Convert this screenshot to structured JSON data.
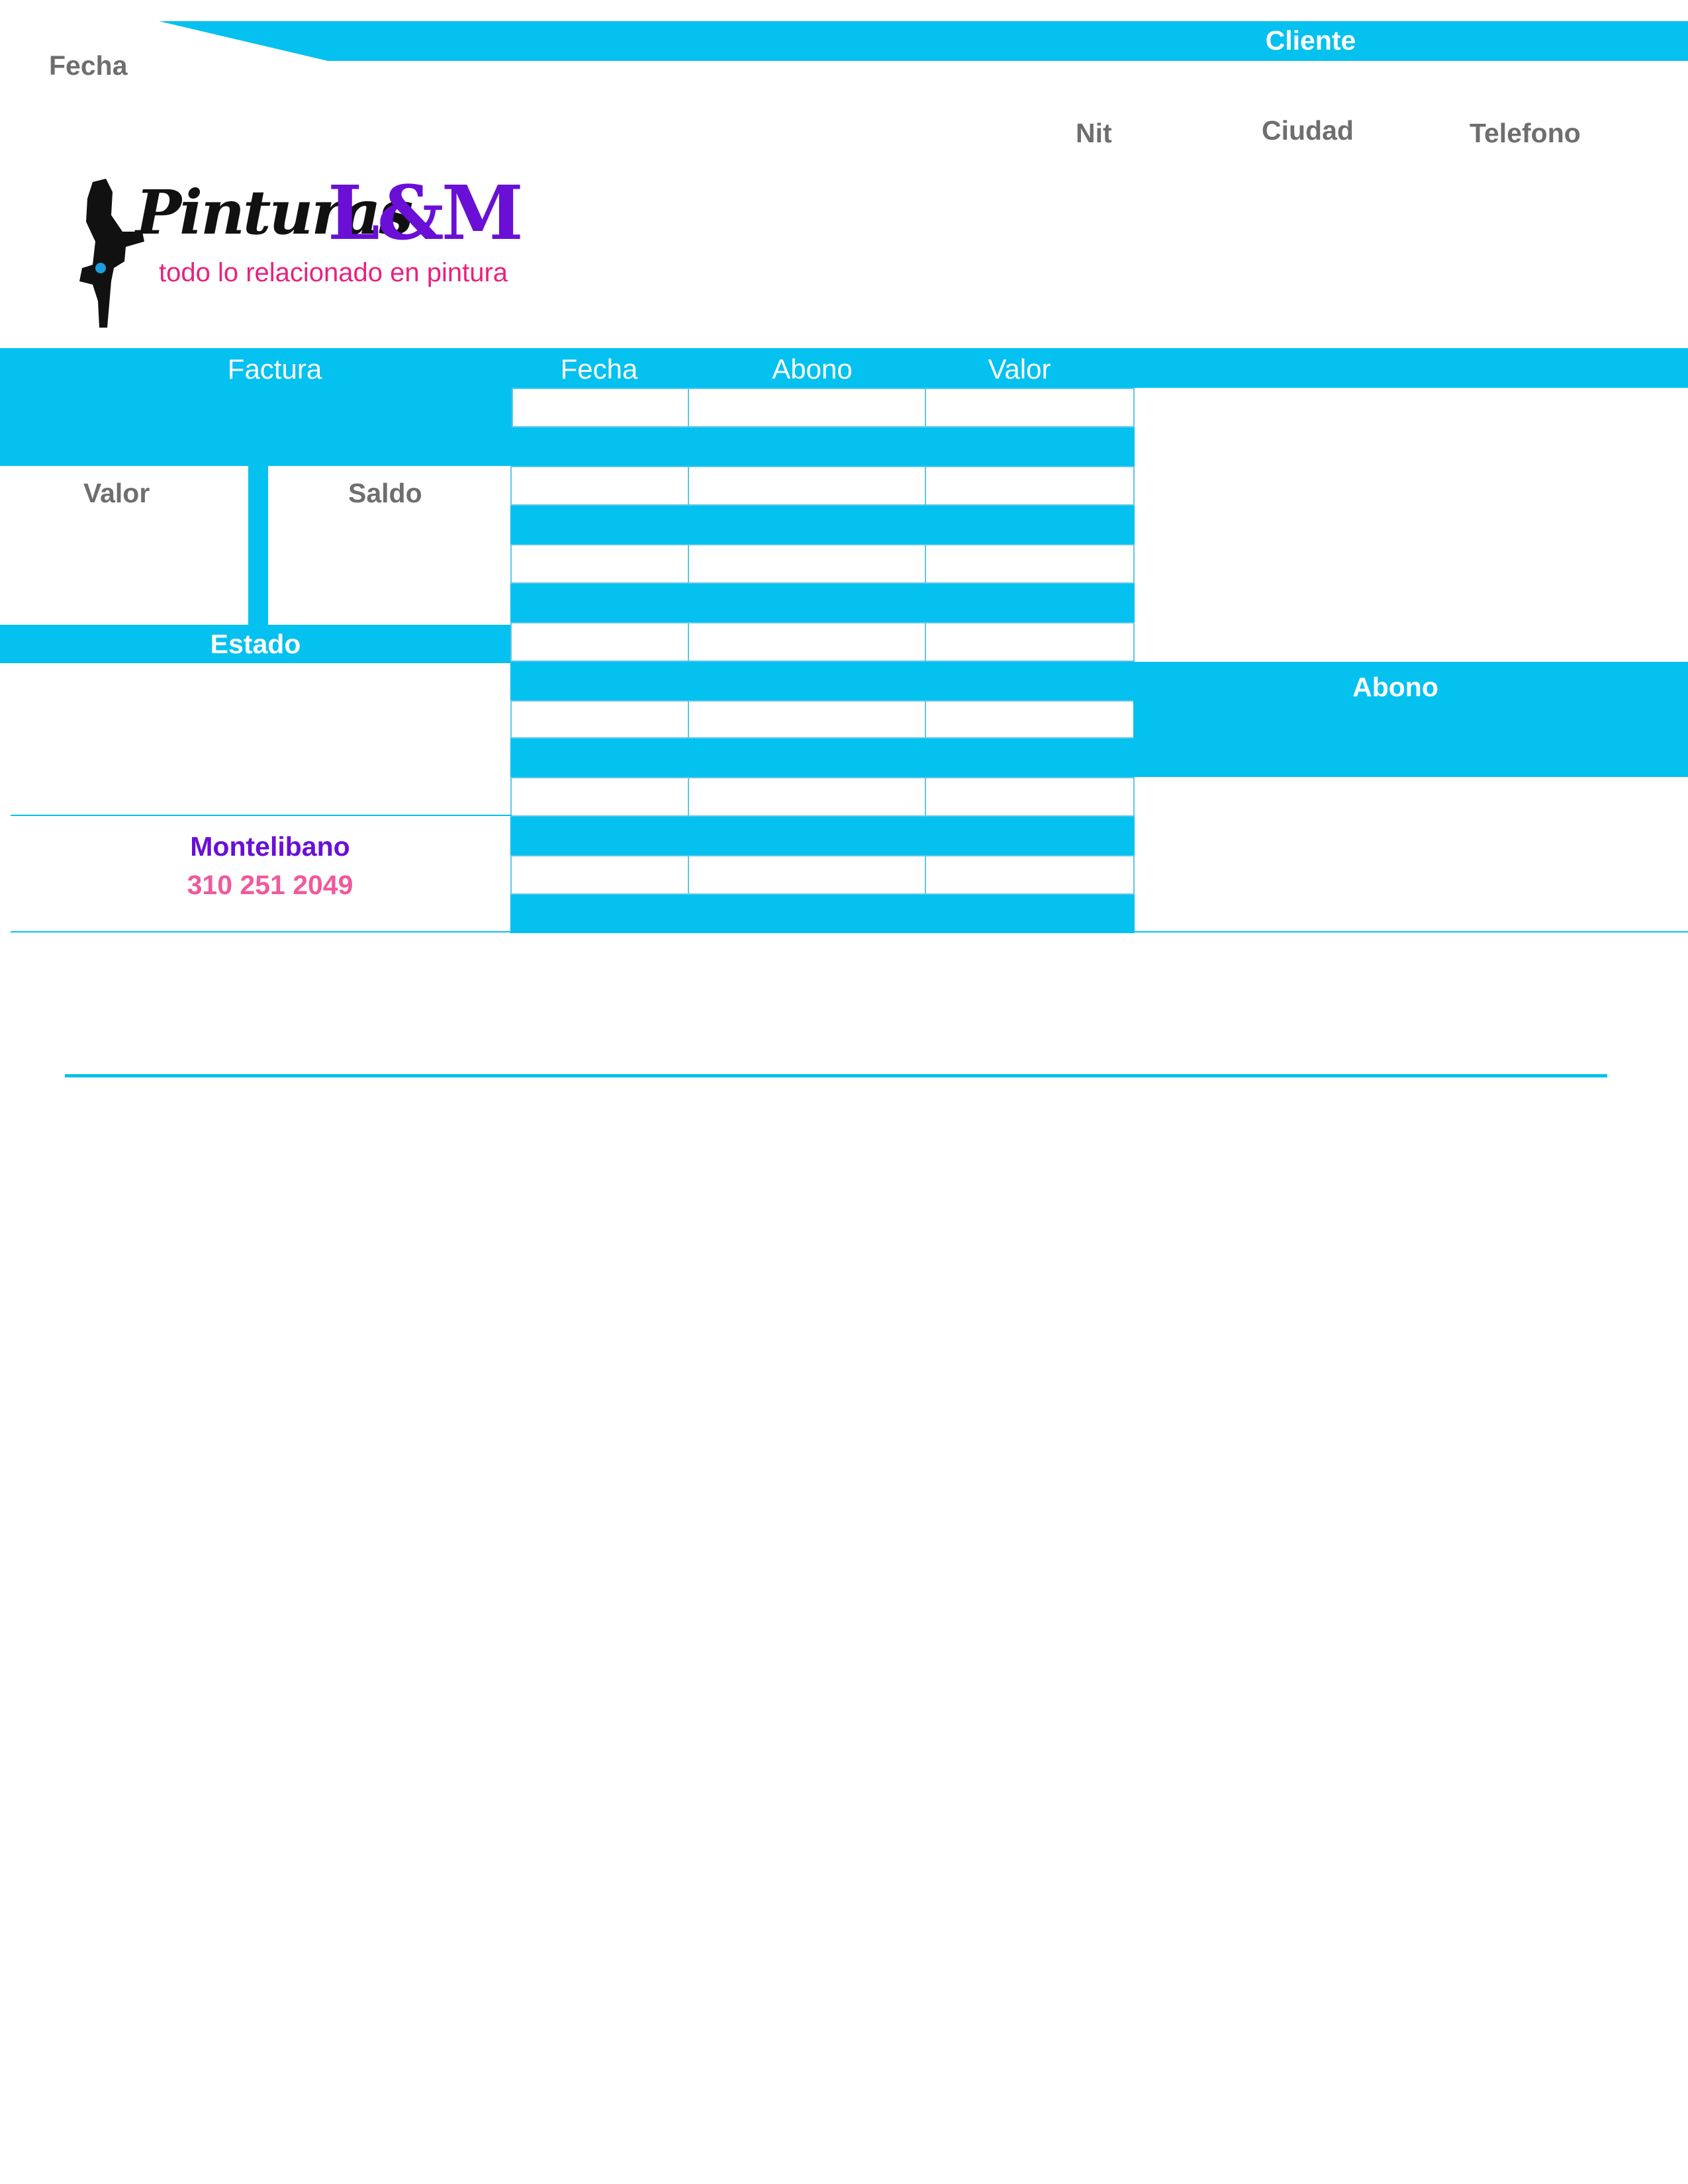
{
  "header": {
    "fecha_label": "Fecha",
    "cliente_label": "Cliente",
    "nit_label": "Nit",
    "ciudad_label": "Ciudad",
    "telefono_label": "Telefono"
  },
  "logo": {
    "text_script": "Pinturas",
    "text_brand": "L&M",
    "tagline": "todo lo relacionado en pintura"
  },
  "table": {
    "col_factura": "Factura",
    "col_fecha": "Fecha",
    "col_abono": "Abono",
    "col_valor": "Valor"
  },
  "left_panel": {
    "valor_label": "Valor",
    "saldo_label": "Saldo",
    "estado_label": "Estado",
    "city": "Montelibano",
    "phone": "310 251 2049"
  },
  "right_panel": {
    "abono_label": "Abono"
  },
  "colors": {
    "accent": "#04c1ef",
    "label_gray": "#6e6e6e",
    "brand_purple": "#6a0fd6",
    "brand_pink": "#e9217e",
    "phone_pink": "#ef5a9c"
  }
}
